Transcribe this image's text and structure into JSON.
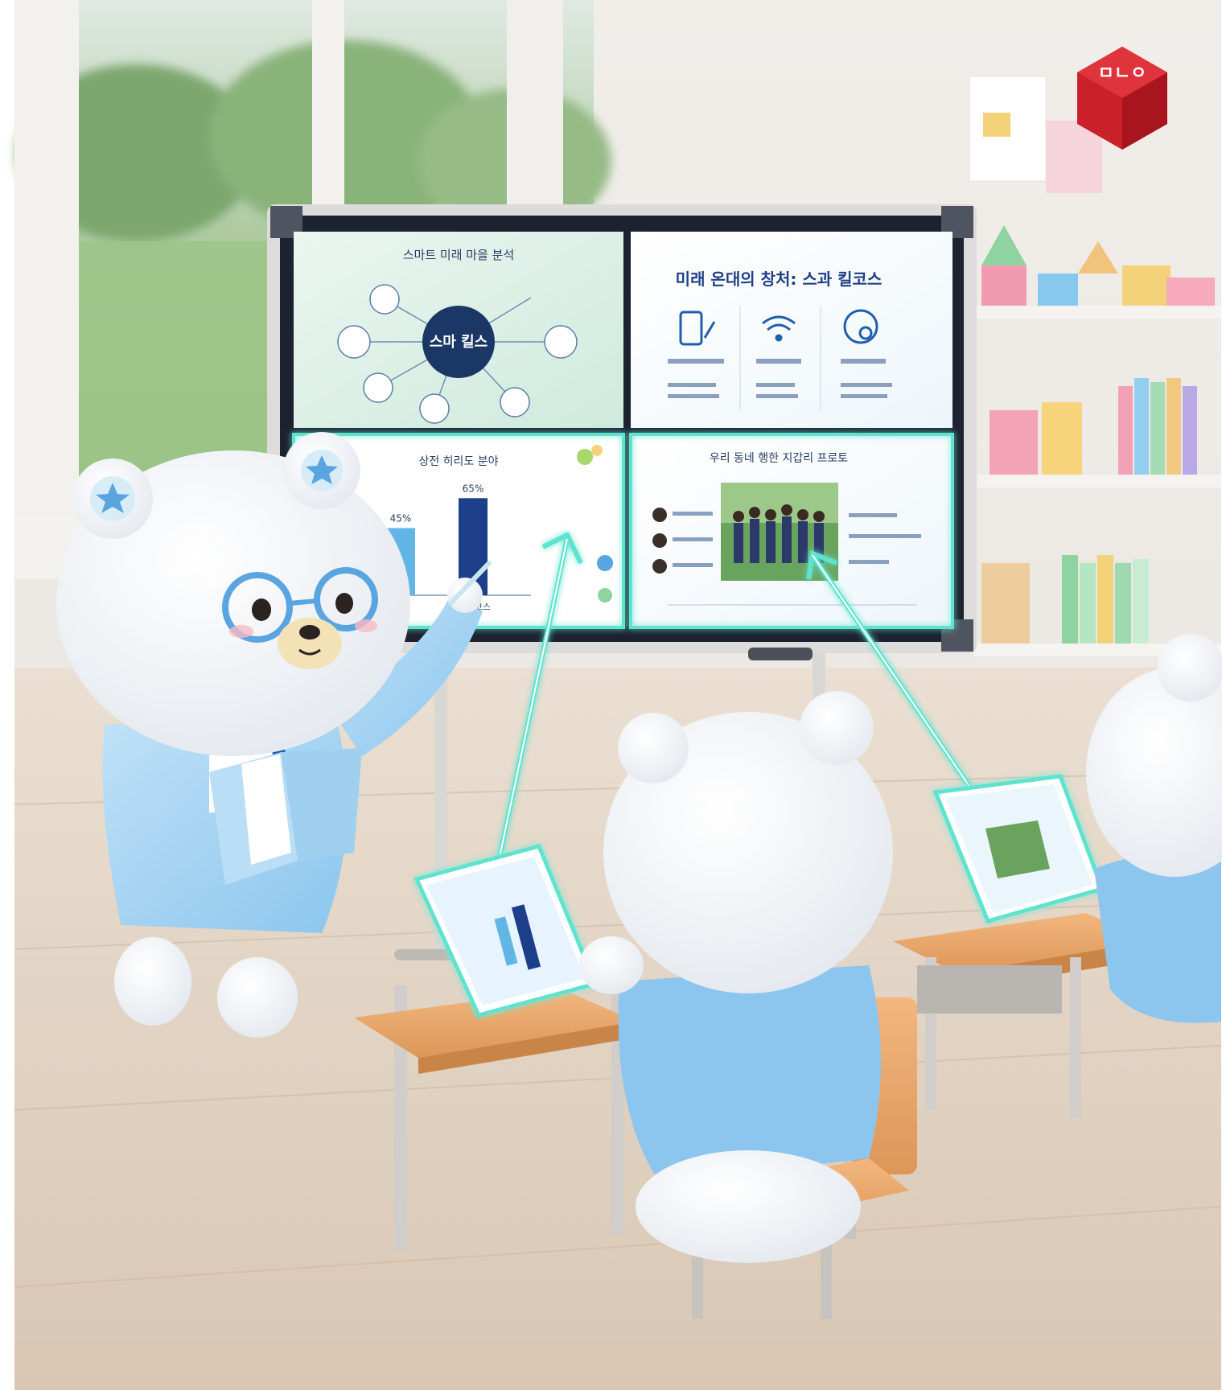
{
  "colors": {
    "glow": "#5fe3cf",
    "bar_dark": "#1d3f8a",
    "bar_light": "#62b6e6",
    "logo": "#c9202a",
    "bear_blue": "#8cc6ee"
  },
  "logo": {
    "letters": "ㅁㄴㅇ"
  },
  "board": {
    "panels": [
      {
        "title": "스마트 미래 마을 분석",
        "center_label": "스마 킬스",
        "icons": [
          "car-icon",
          "book-icon",
          "tree-icon",
          "house-icon",
          "person-icon",
          "bell-icon"
        ]
      },
      {
        "title": "미래 온대의 창처: 스과 킬코스",
        "icons": [
          "tablet-pen-icon",
          "wifi-icon",
          "gear-head-icon"
        ]
      },
      {
        "title": "상전 히리도 분야",
        "chart_data": {
          "type": "bar",
          "categories": [
            "",
            "갑 디코스"
          ],
          "values": [
            45,
            65
          ],
          "data_labels": [
            "45%",
            "65%"
          ]
        }
      },
      {
        "title": "우리 동네 행한 지갑리 프로토",
        "icons": [
          "person-avatar-icon",
          "person-avatar-icon",
          "person-avatar-icon"
        ]
      }
    ]
  }
}
